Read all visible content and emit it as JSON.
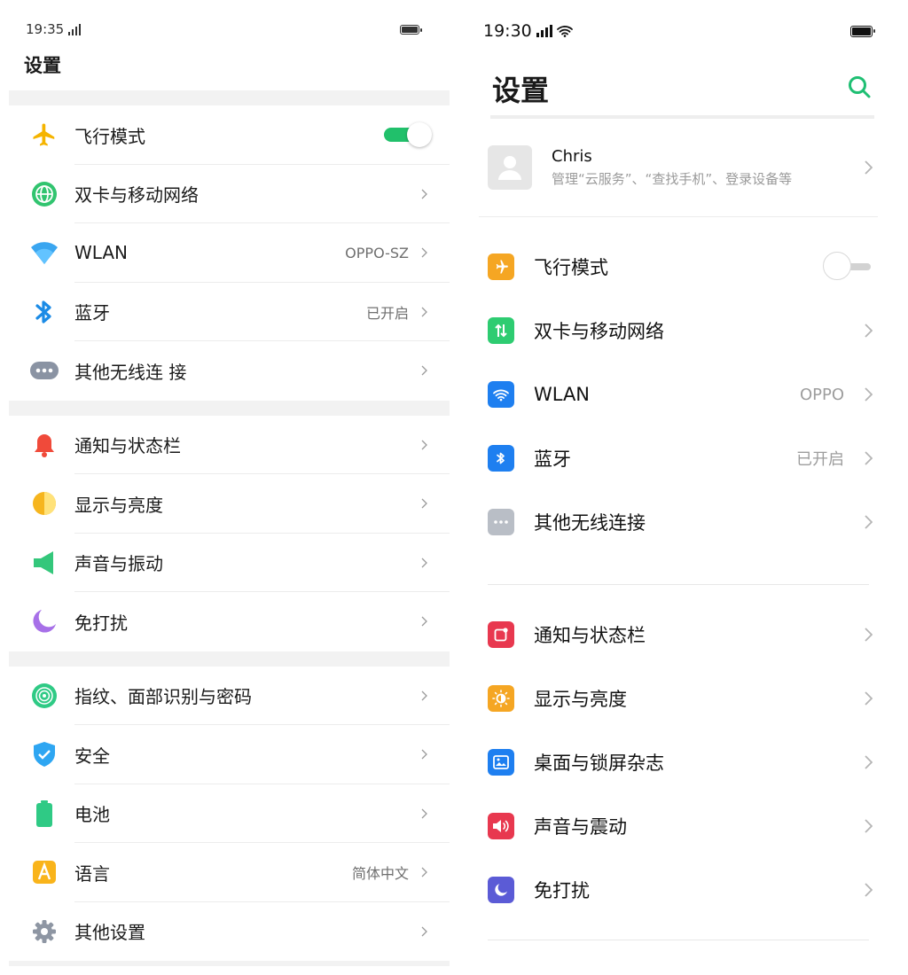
{
  "left": {
    "status": {
      "time": "19:35"
    },
    "title": "设置",
    "items": [
      {
        "label": "飞行模式",
        "value": "",
        "toggle": true
      },
      {
        "label": "双卡与移动网络",
        "value": ""
      },
      {
        "label": "WLAN",
        "value": "OPPO-SZ"
      },
      {
        "label": "蓝牙",
        "value": "已开启"
      },
      {
        "label": "其他无线连 接",
        "value": ""
      },
      {
        "label": "通知与状态栏",
        "value": ""
      },
      {
        "label": "显示与亮度",
        "value": ""
      },
      {
        "label": "声音与振动",
        "value": ""
      },
      {
        "label": "免打扰",
        "value": ""
      },
      {
        "label": "指纹、面部识别与密码",
        "value": ""
      },
      {
        "label": "安全",
        "value": ""
      },
      {
        "label": "电池",
        "value": ""
      },
      {
        "label": "语言",
        "value": "简体中文"
      },
      {
        "label": "其他设置",
        "value": ""
      }
    ]
  },
  "right": {
    "status": {
      "time": "19:30"
    },
    "title": "设置",
    "account": {
      "name": "Chris",
      "subtitle": "管理“云服务”、“查找手机”、登录设备等"
    },
    "items": [
      {
        "label": "飞行模式",
        "value": ""
      },
      {
        "label": "双卡与移动网络",
        "value": ""
      },
      {
        "label": "WLAN",
        "value": "OPPO"
      },
      {
        "label": "蓝牙",
        "value": "已开启"
      },
      {
        "label": "其他无线连接",
        "value": ""
      },
      {
        "label": "通知与状态栏",
        "value": ""
      },
      {
        "label": "显示与亮度",
        "value": ""
      },
      {
        "label": "桌面与锁屏杂志",
        "value": ""
      },
      {
        "label": "声音与震动",
        "value": ""
      },
      {
        "label": "免打扰",
        "value": ""
      }
    ]
  },
  "colors": {
    "toggle_on": "#21c06b",
    "search_icon": "#1fbf73",
    "airplane_orange": "#f5a623",
    "network_green": "#2ecc71",
    "wlan_blue": "#1e7ff0",
    "bluetooth_blue": "#1e7ff0",
    "more_gray": "#b9bec6",
    "notification_red": "#e8384f",
    "display_orange": "#f5a623",
    "wallpaper_blue": "#1e7ff0",
    "sound_red": "#e8384f",
    "dnd_purple": "#5b5bd6"
  }
}
